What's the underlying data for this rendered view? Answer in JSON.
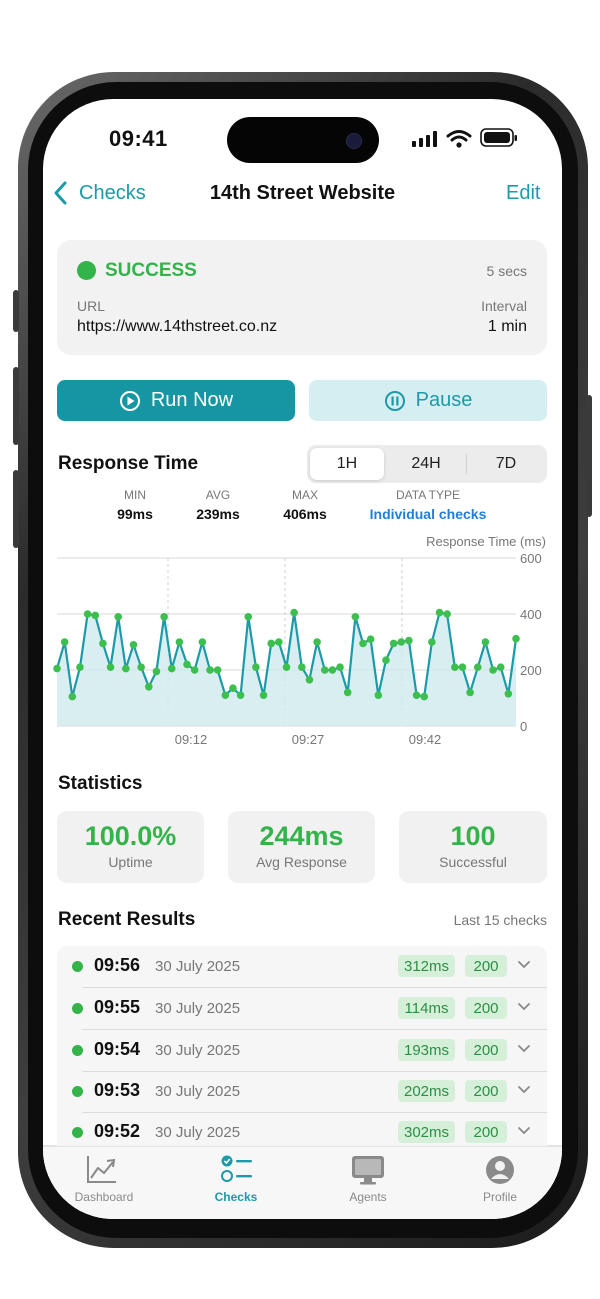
{
  "status_bar": {
    "time": "09:41"
  },
  "nav": {
    "back_label": "Checks",
    "title": "14th Street Website",
    "edit_label": "Edit"
  },
  "status_card": {
    "status": "SUCCESS",
    "duration": "5 secs",
    "url_label": "URL",
    "url": "https://www.14thstreet.co.nz",
    "interval_label": "Interval",
    "interval": "1 min"
  },
  "actions": {
    "run_now": "Run Now",
    "pause": "Pause"
  },
  "response_time": {
    "title": "Response Time",
    "ranges": [
      "1H",
      "24H",
      "7D"
    ],
    "selected_range": "1H",
    "summary": {
      "min_label": "MIN",
      "min": "99ms",
      "avg_label": "AVG",
      "avg": "239ms",
      "max_label": "MAX",
      "max": "406ms",
      "type_label": "DATA TYPE",
      "type": "Individual checks"
    }
  },
  "chart_data": {
    "type": "area",
    "ylabel": "Response Time (ms)",
    "ylim": [
      0,
      600
    ],
    "yticks": [
      "600",
      "400",
      "200",
      "0"
    ],
    "xticks": [
      "09:12",
      "09:27",
      "09:42"
    ],
    "series": [
      {
        "values": [
          205,
          300,
          105,
          210,
          400,
          395,
          295,
          210,
          390,
          205,
          290,
          210,
          140,
          195,
          390,
          205,
          300,
          220,
          200,
          300,
          200,
          200,
          110,
          135,
          110,
          390,
          210,
          110,
          295,
          300,
          210,
          405,
          210,
          165,
          300,
          200,
          200,
          210,
          120,
          390,
          295,
          310,
          110,
          235,
          295,
          300,
          305,
          110,
          105,
          300,
          405,
          400,
          210,
          210,
          120,
          210,
          300,
          200,
          210,
          115,
          312
        ]
      }
    ],
    "colors": {
      "line": "#1c9aa8",
      "points": "#3cbf4e",
      "fill": "#cfeaee"
    }
  },
  "statistics": {
    "title": "Statistics",
    "cards": [
      {
        "value": "100.0%",
        "label": "Uptime"
      },
      {
        "value": "244ms",
        "label": "Avg Response"
      },
      {
        "value": "100",
        "label": "Successful"
      }
    ]
  },
  "recent": {
    "title": "Recent Results",
    "subtitle": "Last 15 checks",
    "rows": [
      {
        "time": "09:56",
        "date": "30 July 2025",
        "ms": "312ms",
        "code": "200"
      },
      {
        "time": "09:55",
        "date": "30 July 2025",
        "ms": "114ms",
        "code": "200"
      },
      {
        "time": "09:54",
        "date": "30 July 2025",
        "ms": "193ms",
        "code": "200"
      },
      {
        "time": "09:53",
        "date": "30 July 2025",
        "ms": "202ms",
        "code": "200"
      },
      {
        "time": "09:52",
        "date": "30 July 2025",
        "ms": "302ms",
        "code": "200"
      }
    ]
  },
  "tabs": [
    {
      "label": "Dashboard",
      "icon": "chart-icon"
    },
    {
      "label": "Checks",
      "icon": "checklist-icon",
      "active": true
    },
    {
      "label": "Agents",
      "icon": "monitor-icon"
    },
    {
      "label": "Profile",
      "icon": "person-icon"
    }
  ],
  "colors": {
    "accent": "#1c9aa8",
    "success": "#34b34a",
    "link": "#1f7fd8"
  }
}
